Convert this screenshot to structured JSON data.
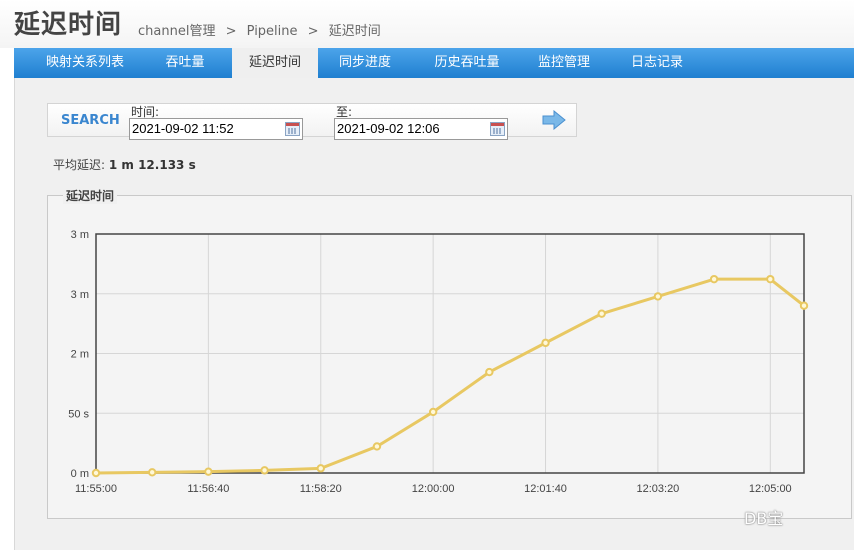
{
  "header": {
    "title": "延迟时间",
    "breadcrumb": [
      "channel管理",
      ">",
      "Pipeline",
      ">",
      "延迟时间"
    ]
  },
  "tabs": [
    {
      "label": "映射关系列表"
    },
    {
      "label": "吞吐量"
    },
    {
      "label": "延迟时间",
      "active": true
    },
    {
      "label": "同步进度"
    },
    {
      "label": "历史吞吐量"
    },
    {
      "label": "监控管理"
    },
    {
      "label": "日志记录"
    }
  ],
  "search": {
    "label": "SEARCH",
    "from_label": "时间:",
    "from_value": "2021-09-02 11:52",
    "to_label": "至:",
    "to_value": "2021-09-02 12:06"
  },
  "summary": {
    "label": "平均延迟:",
    "value": "1 m 12.133 s"
  },
  "chart_section": {
    "legend": "延迟时间"
  },
  "chart_data": {
    "type": "line",
    "x": [
      "11:55:00",
      "11:55:50",
      "11:56:40",
      "11:57:30",
      "11:58:20",
      "11:59:10",
      "12:00:00",
      "12:00:50",
      "12:01:40",
      "12:02:30",
      "12:03:20",
      "12:04:10",
      "12:05:00",
      "12:05:30"
    ],
    "values": [
      0,
      0.5,
      1,
      2,
      3.5,
      20,
      46,
      76,
      98,
      120,
      133,
      146,
      146,
      126
    ],
    "x_ticks": [
      "11:55:00",
      "11:56:40",
      "11:58:20",
      "12:00:00",
      "12:01:40",
      "12:03:20",
      "12:05:00"
    ],
    "y_ticks": [
      "0 m",
      "50 s",
      "2 m",
      "3 m",
      "3 m"
    ],
    "line_color": "#e8c862",
    "grid": true
  },
  "watermark": "DB宝",
  "colors": {
    "tab_bar": "#2a8ad8",
    "search_accent": "#3a86cf"
  }
}
